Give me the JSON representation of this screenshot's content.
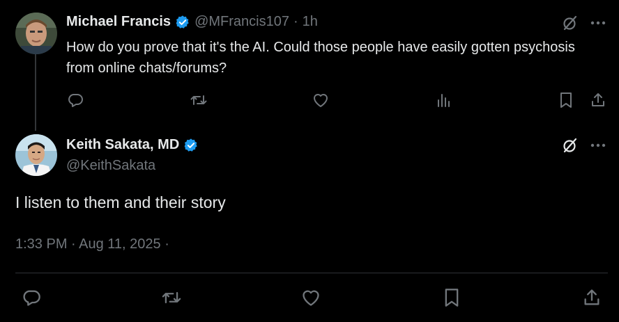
{
  "reply": {
    "author_name": "Michael Francis",
    "handle": "@MFrancis107",
    "separator": "·",
    "time": "1h",
    "text": "How do you prove that it's the AI. Could those people have easily gotten psychosis from online chats/forums?"
  },
  "main": {
    "author_name": "Keith Sakata, MD",
    "handle": "@KeithSakata",
    "text": "I listen to them and their story",
    "timestamp": "1:33 PM · Aug 11, 2025 ·"
  },
  "colors": {
    "background": "#000000",
    "text": "#e7e9ea",
    "muted": "#71767b",
    "verified": "#1d9bf0",
    "divider": "#2f3336"
  },
  "icons": [
    "verified-icon",
    "grok-icon",
    "more-icon",
    "reply-icon",
    "retweet-icon",
    "like-icon",
    "views-icon",
    "bookmark-icon",
    "share-icon"
  ]
}
